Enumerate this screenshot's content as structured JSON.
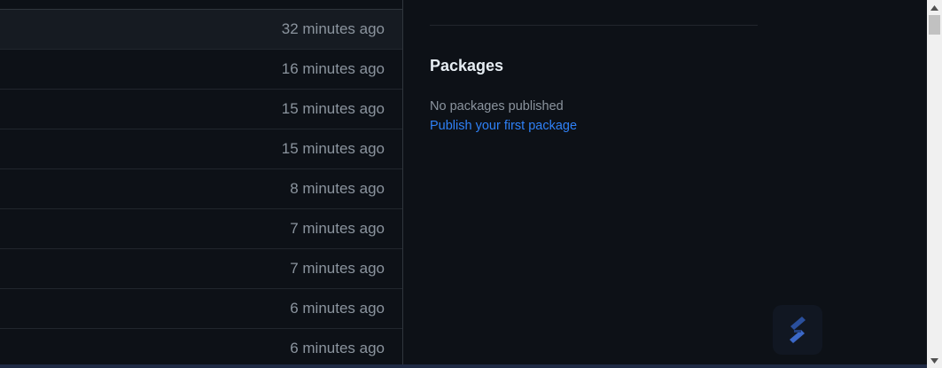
{
  "file_list": {
    "rows": [
      {
        "time": "32 minutes ago"
      },
      {
        "time": "16 minutes ago"
      },
      {
        "time": "15 minutes ago"
      },
      {
        "time": "15 minutes ago"
      },
      {
        "time": "8 minutes ago"
      },
      {
        "time": "7 minutes ago"
      },
      {
        "time": "7 minutes ago"
      },
      {
        "time": "6 minutes ago"
      },
      {
        "time": "6 minutes ago"
      }
    ]
  },
  "sidebar": {
    "packages": {
      "title": "Packages",
      "empty_text": "No packages published",
      "link_text": "Publish your first package"
    }
  },
  "colors": {
    "background": "#0d1117",
    "muted_text": "#8b949e",
    "link": "#2f81f7",
    "heading": "#e6edf3"
  },
  "icons": {
    "floating_widget": "stylized-s-logo-icon",
    "scroll_up": "triangle-up-icon",
    "scroll_down": "triangle-down-icon"
  }
}
